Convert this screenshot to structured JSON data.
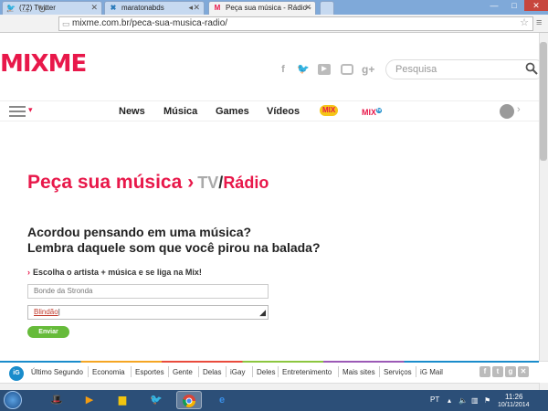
{
  "browser": {
    "tabs": [
      {
        "title": "(72) Twitter",
        "icon": "twitter-bird"
      },
      {
        "title": "maratonabds",
        "icon": "x-favicon"
      },
      {
        "title": "Peça sua música - Rádio -",
        "icon": "mixme-m"
      }
    ],
    "url": "mixme.com.br/peca-sua-musica-radio/"
  },
  "site": {
    "logo": "MIXME",
    "search_placeholder": "Pesquisa",
    "social_icons": [
      "facebook",
      "twitter",
      "youtube",
      "instagram",
      "g+"
    ],
    "nav": [
      "News",
      "Música",
      "Games",
      "Vídeos"
    ],
    "badge_mix_label": "MIX",
    "badge_mix2_label": "MIX",
    "badge_mix2_suffix": "tv",
    "accent_color": "#e8184a"
  },
  "main": {
    "title": "Peça sua música",
    "tv": "TV",
    "slash": "/",
    "radio": "Rádio",
    "question_1": "Acordou pensando em uma música?",
    "question_2": "Lembra daquele som que você pirou na balada?",
    "instruction": "Escolha o artista + música e se liga na Mix!",
    "artist_value": "Bonde da Stronda",
    "song_value": "Blindão",
    "submit_label": "Enviar"
  },
  "portal": {
    "logo": "iG",
    "links": [
      "Último Segundo",
      "Economia",
      "Esportes",
      "Gente",
      "Delas",
      "iGay",
      "Deles",
      "Entretenimento",
      "Mais sites",
      "Serviços",
      "iG Mail"
    ]
  },
  "taskbar": {
    "language": "PT",
    "time": "11:26",
    "date": "10/11/2014"
  }
}
